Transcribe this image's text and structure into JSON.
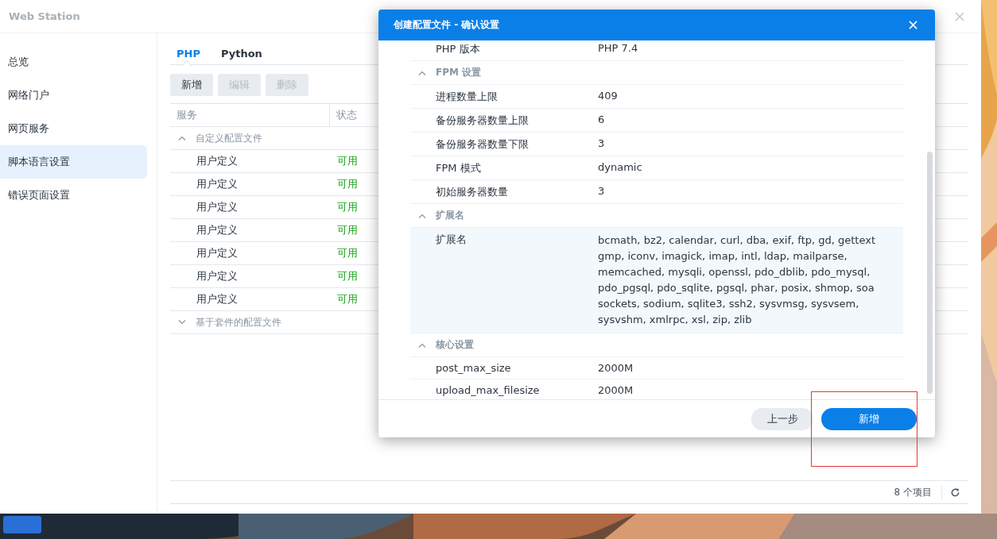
{
  "window": {
    "title": "Web Station",
    "sidebar": {
      "items": [
        {
          "label": "总览",
          "selected": false
        },
        {
          "label": "网络门户",
          "selected": false
        },
        {
          "label": "网页服务",
          "selected": false
        },
        {
          "label": "脚本语言设置",
          "selected": true
        },
        {
          "label": "错误页面设置",
          "selected": false
        }
      ]
    },
    "tabs": [
      {
        "label": "PHP",
        "selected": true
      },
      {
        "label": "Python",
        "selected": false
      }
    ],
    "toolbar": [
      {
        "label": "新增",
        "disabled": false
      },
      {
        "label": "编辑",
        "disabled": true
      },
      {
        "label": "删除",
        "disabled": true
      }
    ],
    "table": {
      "columns": [
        "服务",
        "状态"
      ],
      "groups": [
        {
          "label": "自定义配置文件",
          "expanded": true,
          "rows": [
            {
              "service": "用户定义",
              "status": "可用"
            },
            {
              "service": "用户定义",
              "status": "可用"
            },
            {
              "service": "用户定义",
              "status": "可用"
            },
            {
              "service": "用户定义",
              "status": "可用"
            },
            {
              "service": "用户定义",
              "status": "可用"
            },
            {
              "service": "用户定义",
              "status": "可用"
            },
            {
              "service": "用户定义",
              "status": "可用"
            }
          ]
        },
        {
          "label": "基于套件的配置文件",
          "expanded": false
        }
      ]
    },
    "status_bar": {
      "count": "8 个项目"
    }
  },
  "dialog": {
    "title": "创建配置文件 - 确认设置",
    "sections": [
      {
        "rows": [
          {
            "label": "PHP 版本",
            "value_lines": [
              "PHP 7.4"
            ],
            "selected": false
          }
        ]
      },
      {
        "header": "FPM 设置",
        "expanded": true,
        "rows": [
          {
            "label": "进程数量上限",
            "value_lines": [
              "409"
            ],
            "selected": false
          },
          {
            "label": "备份服务器数量上限",
            "value_lines": [
              "6"
            ],
            "selected": false
          },
          {
            "label": "备份服务器数量下限",
            "value_lines": [
              "3"
            ],
            "selected": false
          },
          {
            "label": "FPM 模式",
            "value_lines": [
              "dynamic"
            ],
            "selected": false
          },
          {
            "label": "初始服务器数量",
            "value_lines": [
              "3"
            ],
            "selected": false
          }
        ]
      },
      {
        "header": "扩展名",
        "expanded": true,
        "rows": [
          {
            "label": "扩展名",
            "value_lines": [
              "bcmath, bz2, calendar, curl, dba, exif, ftp, gd, gettext",
              "gmp, iconv, imagick, imap, intl, ldap, mailparse,",
              "memcached, mysqli, openssl, pdo_dblib, pdo_mysql,",
              "pdo_pgsql, pdo_sqlite, pgsql, phar, posix, shmop, soa",
              "sockets, sodium, sqlite3, ssh2, sysvmsg, sysvsem,",
              "sysvshm, xmlrpc, xsl, zip, zlib"
            ],
            "selected": true
          }
        ]
      },
      {
        "header": "核心设置",
        "expanded": true,
        "rows": [
          {
            "label": "post_max_size",
            "value_lines": [
              "2000M"
            ],
            "selected": false
          },
          {
            "label": "upload_max_filesize",
            "value_lines": [
              "2000M"
            ],
            "selected": false
          }
        ]
      }
    ],
    "buttons": [
      {
        "label": "上一步",
        "kind": "secondary"
      },
      {
        "label": "新增",
        "kind": "primary"
      }
    ]
  }
}
